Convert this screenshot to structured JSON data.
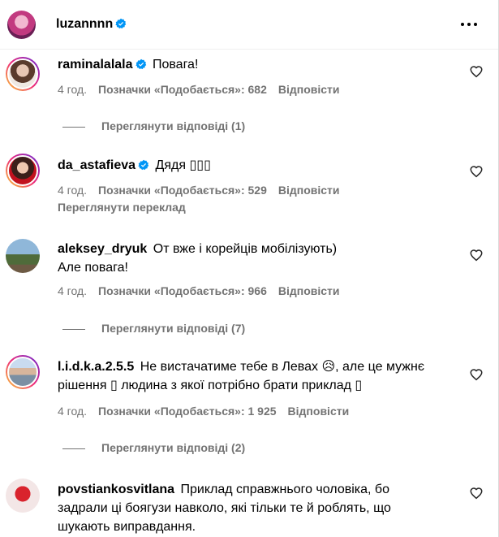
{
  "header": {
    "username": "luzannnn",
    "verified": true,
    "more_icon": "more-horizontal-icon"
  },
  "comments": [
    {
      "username": "raminalalala",
      "verified": true,
      "text": "Повага!",
      "time": "4 год.",
      "likes": "Позначки «Подобається»: 682",
      "reply": "Відповісти",
      "view_replies": "Переглянути відповіді (1)"
    },
    {
      "username": "da_astafieva",
      "verified": true,
      "text": "Дядя ▯▯▯",
      "time": "4 год.",
      "likes": "Позначки «Подобається»: 529",
      "reply": "Відповісти",
      "translation": "Переглянути переклад"
    },
    {
      "username": "aleksey_dryuk",
      "verified": false,
      "text_line1": "От вже і корейців мобілізують)",
      "text_line2": "Але повага!",
      "time": "4 год.",
      "likes": "Позначки «Подобається»: 966",
      "reply": "Відповісти",
      "view_replies": "Переглянути відповіді (7)"
    },
    {
      "username": "l.i.d.k.a.2.5.5",
      "verified": false,
      "text_line1": "Не вистачатиме тебе в Левах 😥, але це мужнє",
      "text_line2": "рішення ▯ людина з якої потрібно брати приклад ▯",
      "time": "4 год.",
      "likes": "Позначки «Подобається»: 1 925",
      "reply": "Відповісти",
      "view_replies": "Переглянути відповіді (2)"
    },
    {
      "username": "povstiankosvitlana",
      "verified": false,
      "text_line1": "Приклад справжнього чоловіка, бо",
      "text_line2": "задрали ці боягузи навколо, які тільки те й роблять, що",
      "text_line3": "шукають виправдання."
    }
  ]
}
